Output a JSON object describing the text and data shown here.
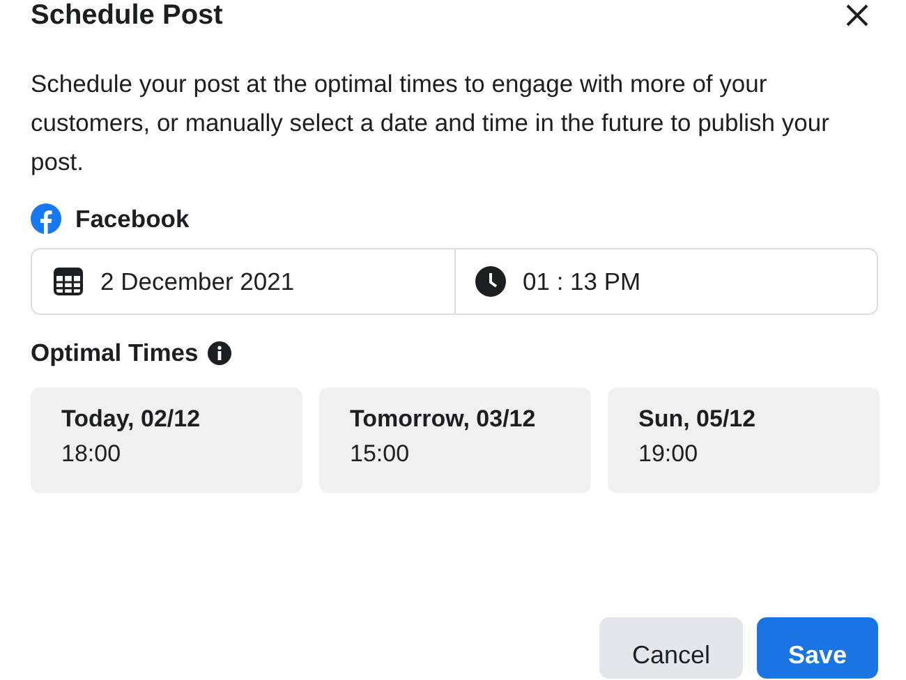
{
  "dialog": {
    "title": "Schedule Post",
    "description": "Schedule your post at the optimal times to engage with more of your customers, or manually select a date and time in the future to publish your post.",
    "platform": "Facebook",
    "date": "2 December 2021",
    "time": "01 : 13 PM",
    "optimal_times_label": "Optimal Times",
    "optimal_times": [
      {
        "day": "Today, 02/12",
        "time": "18:00"
      },
      {
        "day": "Tomorrow, 03/12",
        "time": "15:00"
      },
      {
        "day": "Sun, 05/12",
        "time": "19:00"
      }
    ],
    "buttons": [
      {
        "label": "Cancel",
        "kind": "secondary"
      },
      {
        "label": "Save",
        "kind": "primary"
      }
    ]
  }
}
